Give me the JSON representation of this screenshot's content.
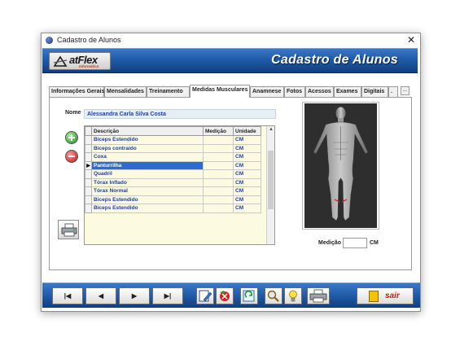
{
  "window": {
    "title": "Cadastro de Alunos",
    "close_symbol": "✕"
  },
  "banner": {
    "logo_text": "atFlex",
    "logo_subtext": "Informática",
    "title": "Cadastro de Alunos",
    "brand_color": "#1f5ba8"
  },
  "tabs": [
    {
      "label": "Informações Gerais",
      "active": false
    },
    {
      "label": "Mensalidades",
      "active": false
    },
    {
      "label": "Treinamento",
      "active": false
    },
    {
      "label": "Medidas Musculares",
      "active": true
    },
    {
      "label": "Anamnese",
      "active": false
    },
    {
      "label": "Fotos",
      "active": false
    },
    {
      "label": "Acessos",
      "active": false
    },
    {
      "label": "Exames",
      "active": false
    },
    {
      "label": "Digitais",
      "active": false
    },
    {
      "label": ".",
      "active": false
    }
  ],
  "tab_overflow": "...",
  "form": {
    "name_label": "Nome",
    "name_value": "Alessandra Carla Silva Costa"
  },
  "grid": {
    "columns": [
      "Descrição",
      "Medição",
      "Unidade"
    ],
    "current_row_marker": "▶",
    "rows": [
      {
        "descricao": "Biceps Estendido",
        "medicao": "",
        "unidade": "CM"
      },
      {
        "descricao": "Biceps contraído",
        "medicao": "",
        "unidade": "CM"
      },
      {
        "descricao": "Coxa",
        "medicao": "",
        "unidade": "CM"
      },
      {
        "descricao": "Panturrilha",
        "medicao": "",
        "unidade": "CM"
      },
      {
        "descricao": "Quadril",
        "medicao": "",
        "unidade": "CM"
      },
      {
        "descricao": "Tórax Inflado",
        "medicao": "",
        "unidade": "CM"
      },
      {
        "descricao": "Tórax Normal",
        "medicao": "",
        "unidade": "CM"
      },
      {
        "descricao": "Biceps Estendido",
        "medicao": "",
        "unidade": "CM"
      },
      {
        "descricao": "Biceps Estendido",
        "medicao": "",
        "unidade": "CM"
      }
    ],
    "selected_row": 3
  },
  "medicao": {
    "label": "Medição",
    "value": "",
    "unit": "CM"
  },
  "toolbar": {
    "first": "|◀",
    "prev": "◀",
    "next": "▶",
    "last": "▶|",
    "exit_label": "sair"
  }
}
